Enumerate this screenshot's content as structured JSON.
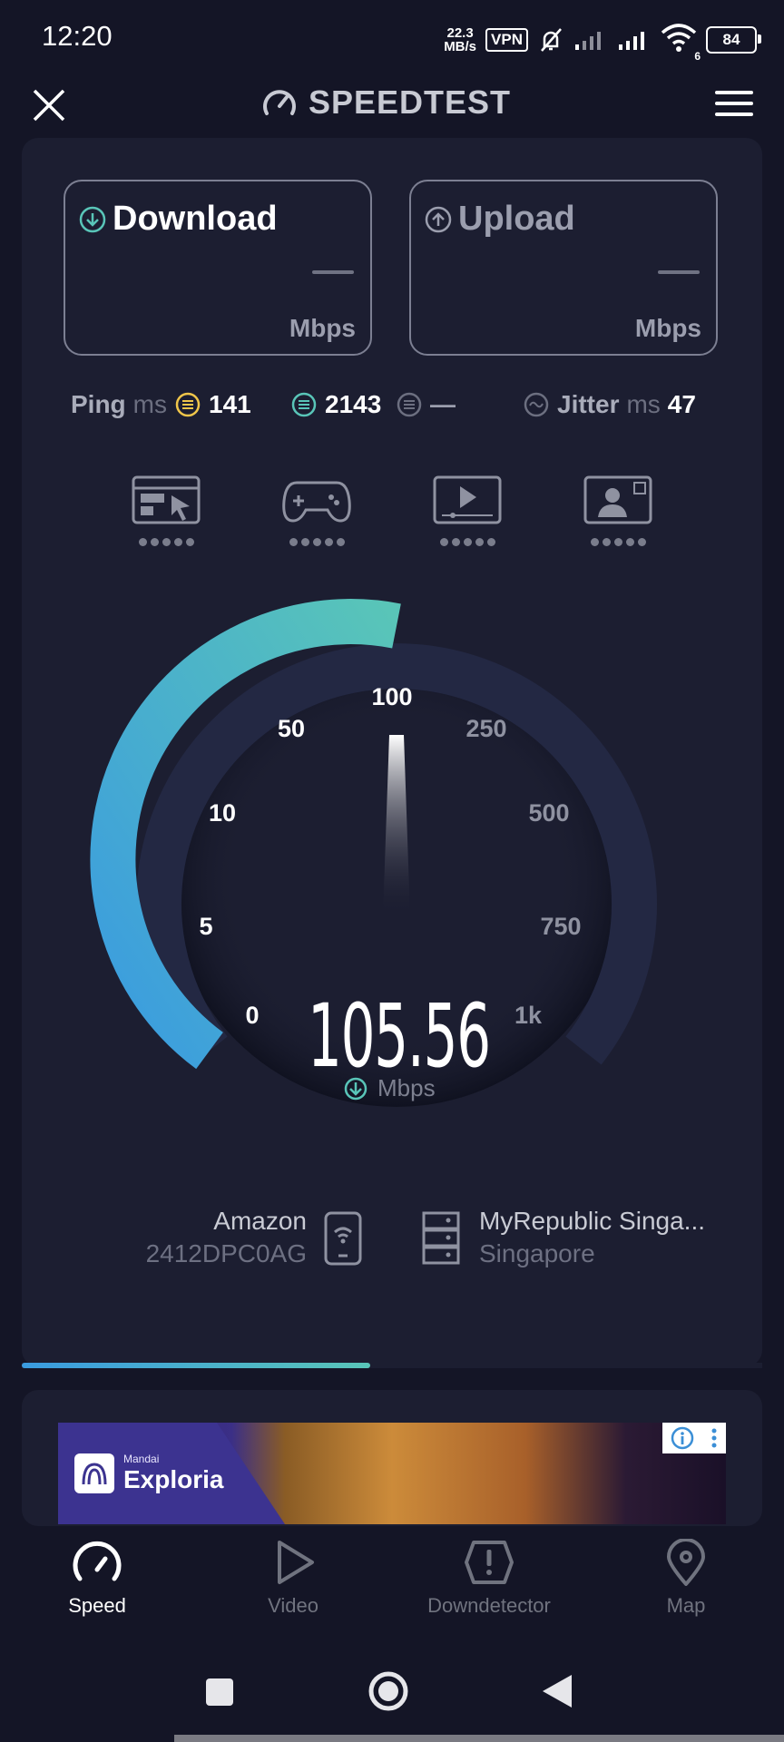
{
  "status_bar": {
    "time": "12:20",
    "net_speed_value": "22.3",
    "net_speed_unit": "MB/s",
    "vpn": "VPN",
    "wifi_badge": "6",
    "battery": "84"
  },
  "header": {
    "title": "SPEEDTEST"
  },
  "download": {
    "label": "Download",
    "unit": "Mbps"
  },
  "upload": {
    "label": "Upload",
    "unit": "Mbps"
  },
  "stats": {
    "ping_label": "Ping",
    "ping_unit": "ms",
    "ping_idle": "141",
    "ping_download": "2143",
    "ping_upload": "—",
    "jitter_label": "Jitter",
    "jitter_unit": "ms",
    "jitter_value": "47"
  },
  "quality_icons": [
    "browsing-icon",
    "gaming-icon",
    "video-streaming-icon",
    "video-call-icon"
  ],
  "gauge": {
    "labels": [
      "0",
      "5",
      "10",
      "50",
      "100",
      "250",
      "500",
      "750",
      "1k"
    ],
    "speed_value": "105.56",
    "speed_unit": "Mbps",
    "colors": {
      "active_start": "#3a9be0",
      "active_end": "#59c5b8",
      "inactive": "#232843"
    }
  },
  "provider": {
    "name": "Amazon",
    "device": "2412DPC0AG"
  },
  "server": {
    "name": "MyRepublic Singa...",
    "location": "Singapore"
  },
  "progress": {
    "fraction": 0.47
  },
  "ad": {
    "brand_small": "Mandai",
    "brand": "Exploria"
  },
  "bottom_nav": {
    "items": [
      {
        "label": "Speed",
        "active": true
      },
      {
        "label": "Video",
        "active": false
      },
      {
        "label": "Downdetector",
        "active": false
      },
      {
        "label": "Map",
        "active": false
      }
    ]
  }
}
